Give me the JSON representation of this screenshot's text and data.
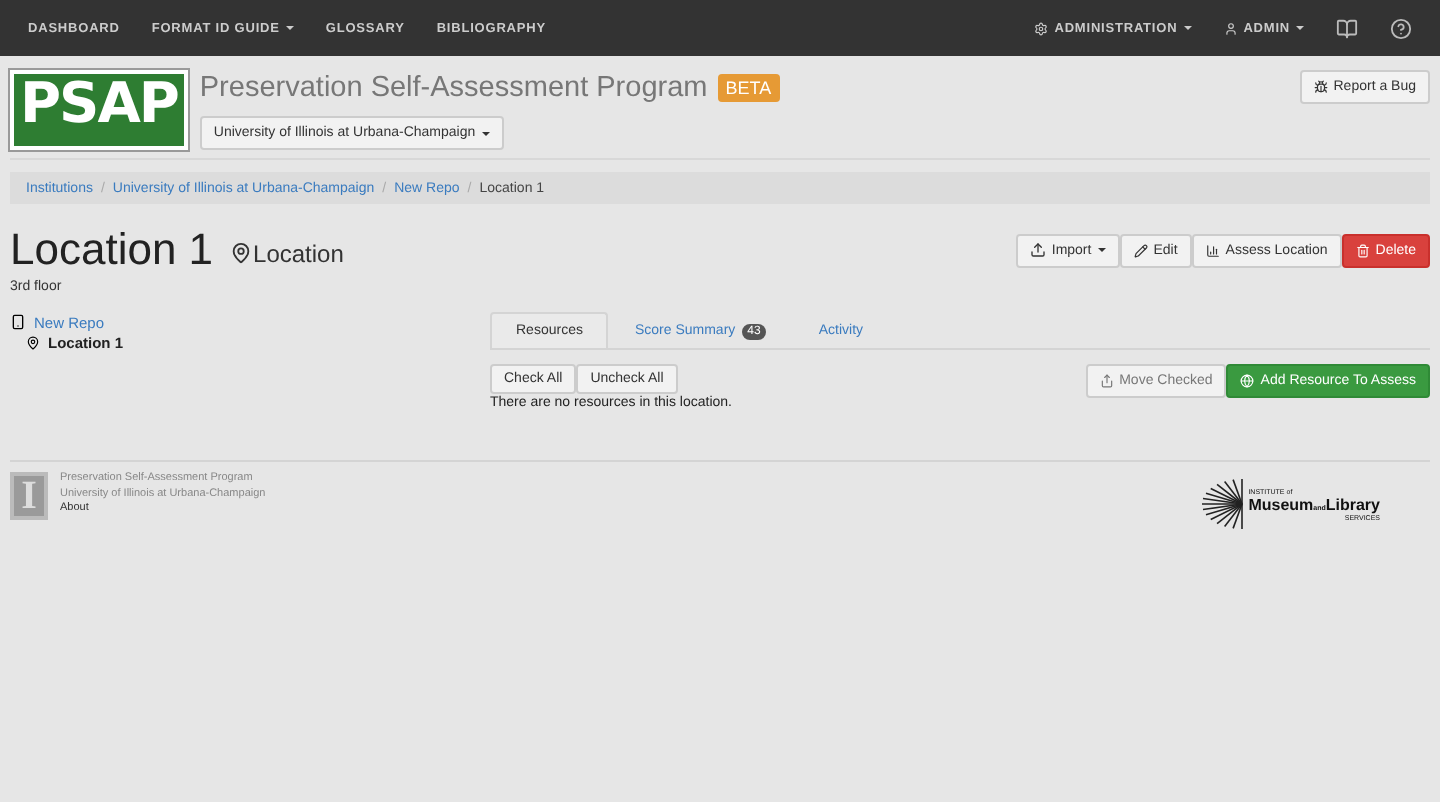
{
  "navbar": {
    "left": [
      {
        "label": "DASHBOARD",
        "dropdown": false
      },
      {
        "label": "FORMAT ID GUIDE",
        "dropdown": true
      },
      {
        "label": "GLOSSARY",
        "dropdown": false
      },
      {
        "label": "BIBLIOGRAPHY",
        "dropdown": false
      }
    ],
    "right": [
      {
        "label": "ADMINISTRATION",
        "kind": "gear",
        "dropdown": true
      },
      {
        "label": "ADMIN",
        "kind": "user",
        "dropdown": true
      },
      {
        "kind": "book"
      },
      {
        "kind": "help"
      }
    ]
  },
  "header": {
    "logo": "PSAP",
    "title": "Preservation Self-Assessment Program",
    "badge": "BETA",
    "institution": "University of Illinois at Urbana-Champaign",
    "report": "Report a Bug"
  },
  "breadcrumbs": [
    {
      "label": "Institutions",
      "link": true
    },
    {
      "separator": "/",
      "label": "University of Illinois at Urbana-Champaign",
      "link": true
    },
    {
      "separator": "/",
      "label": "New Repo",
      "link": true
    },
    {
      "separator": "/",
      "label": "Location 1",
      "link": false
    }
  ],
  "page": {
    "title": "Location 1",
    "subtitle": "Location",
    "description": "3rd floor"
  },
  "actions": [
    {
      "label": "Import",
      "kind": "import",
      "dropdown": true
    },
    {
      "label": "Edit",
      "kind": "edit",
      "dropdown": false
    },
    {
      "label": "Assess Location",
      "kind": "chart",
      "dropdown": false
    },
    {
      "label": "Delete",
      "kind": "delete",
      "dropdown": false
    }
  ],
  "tree": [
    {
      "label": "New Repo",
      "kind": "repo",
      "children": [
        {
          "label": "Location 1",
          "kind": "location"
        }
      ]
    }
  ],
  "tabs": [
    {
      "label": "Resources",
      "selected": true
    },
    {
      "label": "Score Summary",
      "badge": "43",
      "selected": false
    },
    {
      "label": "Activity",
      "selected": false
    }
  ],
  "check_buttons": [
    "Check All",
    "Uncheck All"
  ],
  "empty_message": "There are no resources in this location.",
  "resource_actions": [
    {
      "label": "Move Checked",
      "kind": "move"
    },
    {
      "label": "Add Resource To Assess",
      "kind": "add"
    }
  ],
  "footer": {
    "logo": "I",
    "lines": [
      {
        "label": "Preservation Self-Assessment Program",
        "link": false
      },
      {
        "label": "University of Illinois at Urbana-Champaign",
        "link": false
      },
      {
        "label": "About",
        "link": true
      }
    ],
    "sponsor": {
      "top": "INSTITUTE of",
      "left": "Museum",
      "mid": "and",
      "right": "Library",
      "bottom": "SERVICES"
    }
  }
}
